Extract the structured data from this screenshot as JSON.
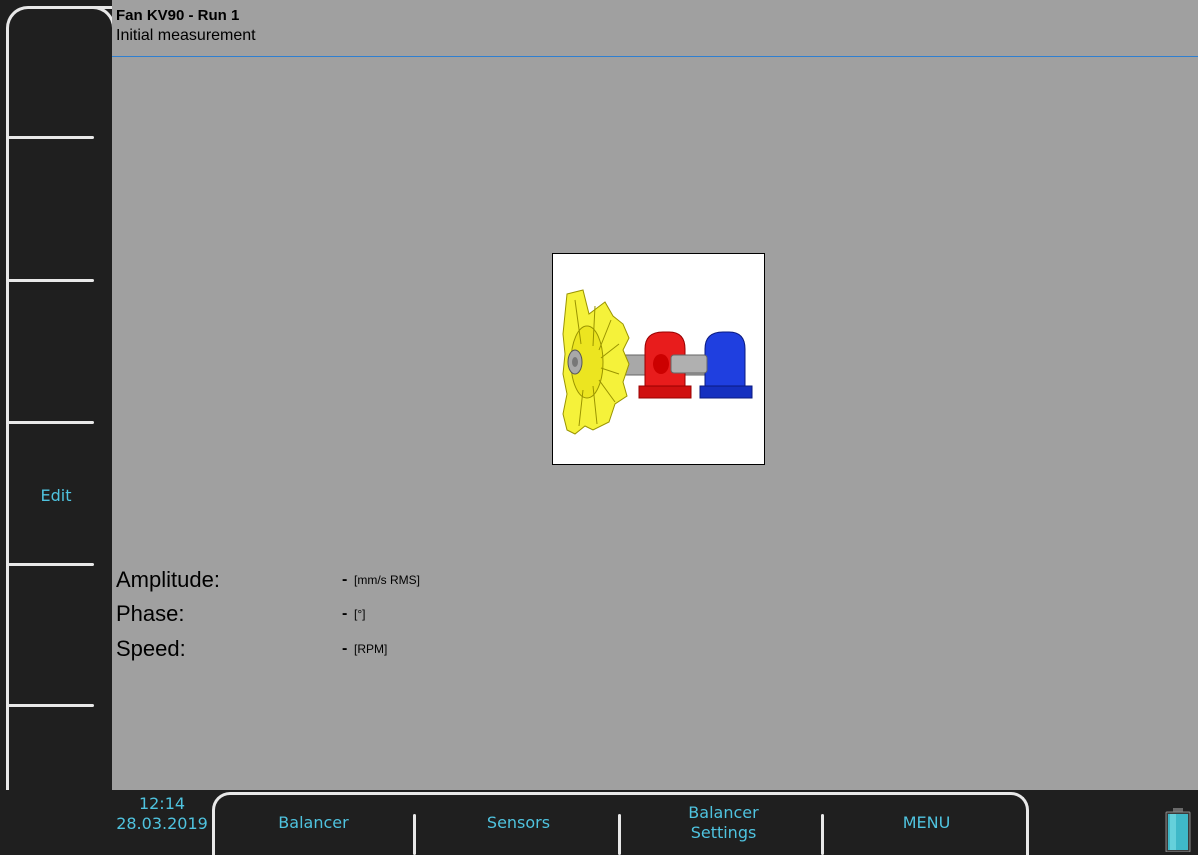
{
  "header": {
    "title": "Fan KV90 - Run 1",
    "subtitle": "Initial measurement"
  },
  "left_softkeys": [
    "",
    "",
    "",
    "Edit",
    "",
    ""
  ],
  "measurements": [
    {
      "label": "Amplitude:",
      "value": "-",
      "unit": "[mm/s RMS]"
    },
    {
      "label": "Phase:",
      "value": "-",
      "unit": "[°]"
    },
    {
      "label": "Speed:",
      "value": "-",
      "unit": "[RPM]"
    }
  ],
  "status": {
    "time": "12:14",
    "date": "28.03.2019"
  },
  "bottom_keys": {
    "balancer": "Balancer",
    "sensors": "Sensors",
    "balancer_settings_line1": "Balancer",
    "balancer_settings_line2": "Settings",
    "menu": "MENU"
  },
  "icons": {
    "battery": "battery-icon",
    "machine": "fan-rotor-illustration"
  },
  "colors": {
    "accent": "#4fc3df",
    "rule": "#2f7fd0",
    "fan": "#f5f23a",
    "bearing1": "#e81c1c",
    "bearing2": "#1f3fe0"
  }
}
